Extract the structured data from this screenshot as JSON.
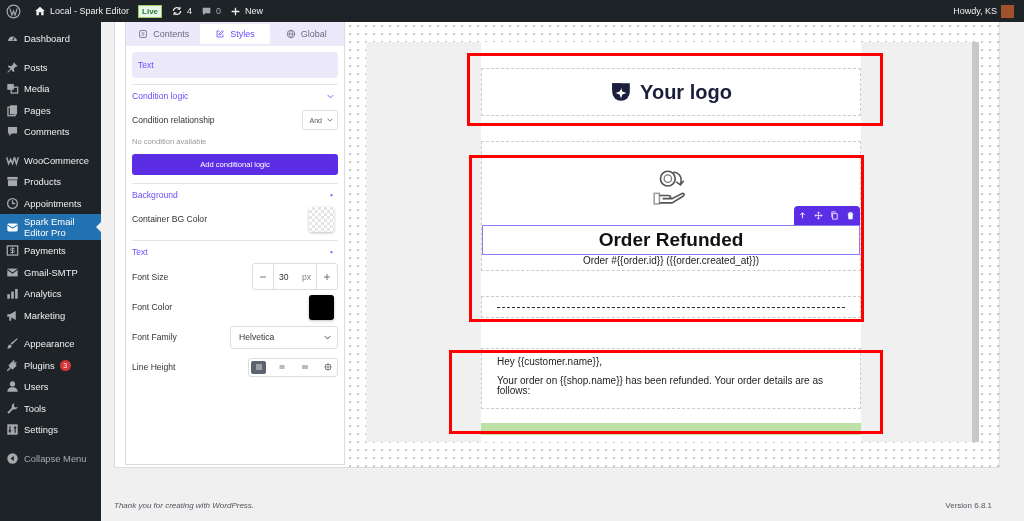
{
  "admin_bar": {
    "site": "Local - Spark Editor",
    "badge": "Live",
    "updates": "4",
    "comments": "0",
    "new": "New",
    "greeting": "Howdy, KS"
  },
  "sidebar": {
    "groups": [
      {
        "items": [
          {
            "label": "Dashboard",
            "selected": false
          }
        ]
      },
      {
        "items": [
          {
            "label": "Posts",
            "selected": false
          },
          {
            "label": "Media",
            "selected": false
          },
          {
            "label": "Pages",
            "selected": false
          },
          {
            "label": "Comments",
            "selected": false
          }
        ]
      },
      {
        "items": [
          {
            "label": "WooCommerce",
            "selected": false
          },
          {
            "label": "Products",
            "selected": false
          },
          {
            "label": "Appointments",
            "selected": false
          },
          {
            "label": "Spark Email Editor Pro",
            "selected": true
          },
          {
            "label": "Payments",
            "selected": false
          },
          {
            "label": "Gmail-SMTP",
            "selected": false
          },
          {
            "label": "Analytics",
            "selected": false
          },
          {
            "label": "Marketing",
            "selected": false
          }
        ]
      },
      {
        "items": [
          {
            "label": "Appearance",
            "selected": false
          },
          {
            "label": "Plugins",
            "selected": false,
            "badge": "3"
          },
          {
            "label": "Users",
            "selected": false
          },
          {
            "label": "Tools",
            "selected": false
          },
          {
            "label": "Settings",
            "selected": false
          }
        ]
      }
    ],
    "collapse": "Collapse Menu"
  },
  "editor_panel": {
    "tabs": [
      {
        "label": "Contents",
        "selected": false
      },
      {
        "label": "Styles",
        "selected": true
      },
      {
        "label": "Global",
        "selected": false
      }
    ],
    "block_label": "Text",
    "condition_logic": {
      "title": "Condition logic",
      "relationship_label": "Condition relationship",
      "relationship_value": "And",
      "empty_note": "No condition available",
      "button": "Add conditional logic"
    },
    "background": {
      "title": "Background",
      "bg_color_label": "Container BG Color"
    },
    "text": {
      "title": "Text",
      "font_size_label": "Font Size",
      "font_size_value": "30",
      "font_size_unit": "px",
      "font_color_label": "Font Color",
      "font_family_label": "Font Family",
      "font_family_value": "Helvetica",
      "line_height_label": "Line Height",
      "line_height_options": [
        {
          "selected": true
        },
        {
          "selected": false
        },
        {
          "selected": false
        },
        {
          "selected": false
        }
      ]
    }
  },
  "email": {
    "logo_text": "Your logo",
    "heading": "Order Refunded",
    "subtitle": "Order #{{order.id}} ({{order.created_at}})",
    "greeting": "Hey {{customer.name}},",
    "body": "Your order on {{shop.name}} has been refunded. Your order details are as follows:"
  },
  "footer": {
    "thanks": "Thank you for creating with WordPress.",
    "version": "Version 6.8.1"
  }
}
